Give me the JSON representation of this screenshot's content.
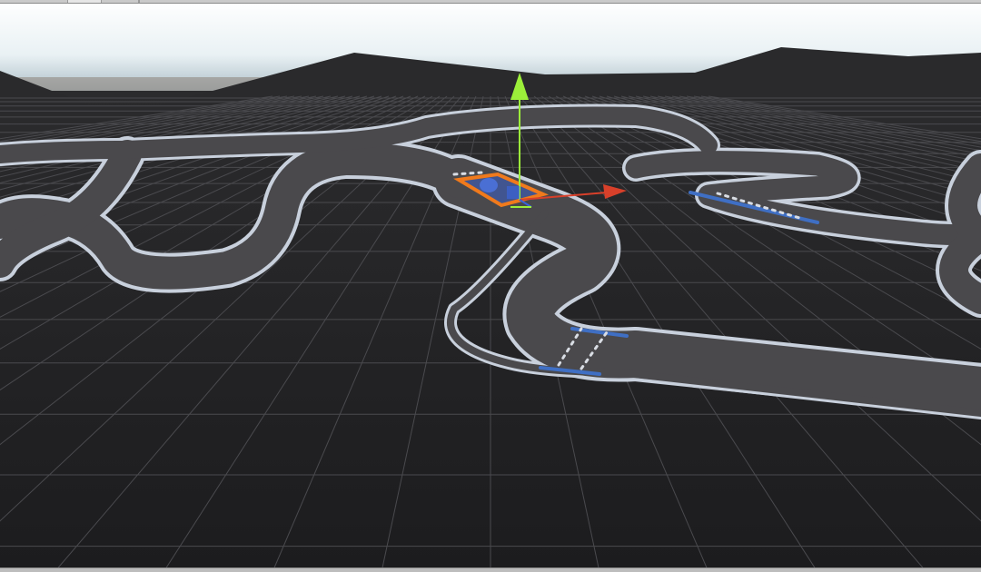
{
  "scene_view": {
    "view": "perspective",
    "grid_visible": true,
    "skybox_visible": true,
    "selected_object": {
      "gizmo": "move-tool",
      "axes": [
        "x-axis",
        "y-axis",
        "z-axis"
      ]
    }
  },
  "colors": {
    "sky_top": "#ffffff",
    "sky_horizon": "#cfe0e8",
    "ground": "#1f1f21",
    "grid": "#4a4a4d",
    "mountains": "#2a2a2c",
    "track_surface": "#4a494c",
    "track_border": "#c8d0dc",
    "track_marker": "#3f6fc4",
    "selection_outline": "#f07a1c",
    "axis_x": "#d8402a",
    "axis_y": "#9cef3a",
    "axis_z": "#3a64d8"
  }
}
